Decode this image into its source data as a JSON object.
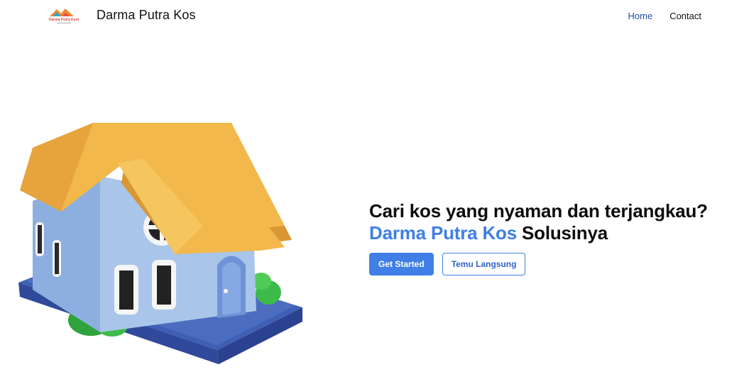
{
  "navbar": {
    "logo_text": "Darma Putra Kost",
    "brand_name": "Darma Putra Kos",
    "links": [
      {
        "label": "Home"
      },
      {
        "label": "Contact"
      }
    ]
  },
  "hero": {
    "headline_line1": "Cari kos yang nyaman dan terjangkau?",
    "headline_accent": "Darma Putra Kos",
    "headline_rest": " Solusinya",
    "primary_button": "Get Started",
    "secondary_button": "Temu Langsung"
  },
  "colors": {
    "accent": "#3f7fe6",
    "nav_active": "#1e4fa8",
    "roof": "#f2b84b",
    "wall": "#a9c6ea",
    "base": "#4c6dbf",
    "bush": "#3dbb4a"
  },
  "icons": {
    "logo": "house-roof-logo",
    "hero": "house-illustration"
  }
}
